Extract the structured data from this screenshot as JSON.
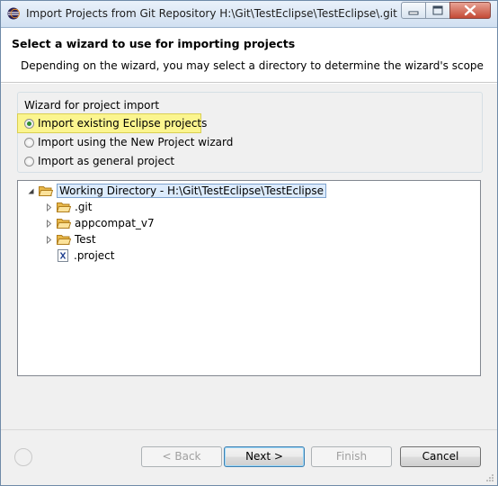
{
  "window": {
    "title": "Import Projects from Git Repository H:\\Git\\TestEclipse\\TestEclipse\\.git",
    "controls": [
      "minimize",
      "maximize",
      "close"
    ]
  },
  "header": {
    "title": "Select a wizard to use for importing projects",
    "description": "Depending on the wizard, you may select a directory to determine the wizard's scope"
  },
  "wizard_group": {
    "label": "Wizard for project import",
    "options": [
      {
        "label": "Import existing Eclipse projects",
        "checked": true
      },
      {
        "label": "Import using the New Project wizard",
        "checked": false
      },
      {
        "label": "Import as general project",
        "checked": false
      }
    ]
  },
  "tree": {
    "root": {
      "label": "Working Directory - H:\\Git\\TestEclipse\\TestEclipse",
      "expanded": true,
      "icon": "folder-open-icon"
    },
    "children": [
      {
        "label": ".git",
        "icon": "folder-icon",
        "expandable": true
      },
      {
        "label": "appcompat_v7",
        "icon": "folder-icon",
        "expandable": true
      },
      {
        "label": "Test",
        "icon": "folder-icon",
        "expandable": true
      },
      {
        "label": ".project",
        "icon": "xml-file-icon",
        "expandable": false
      }
    ]
  },
  "buttons": {
    "help": "?",
    "back": "< Back",
    "next": "Next >",
    "finish": "Finish",
    "cancel": "Cancel"
  }
}
